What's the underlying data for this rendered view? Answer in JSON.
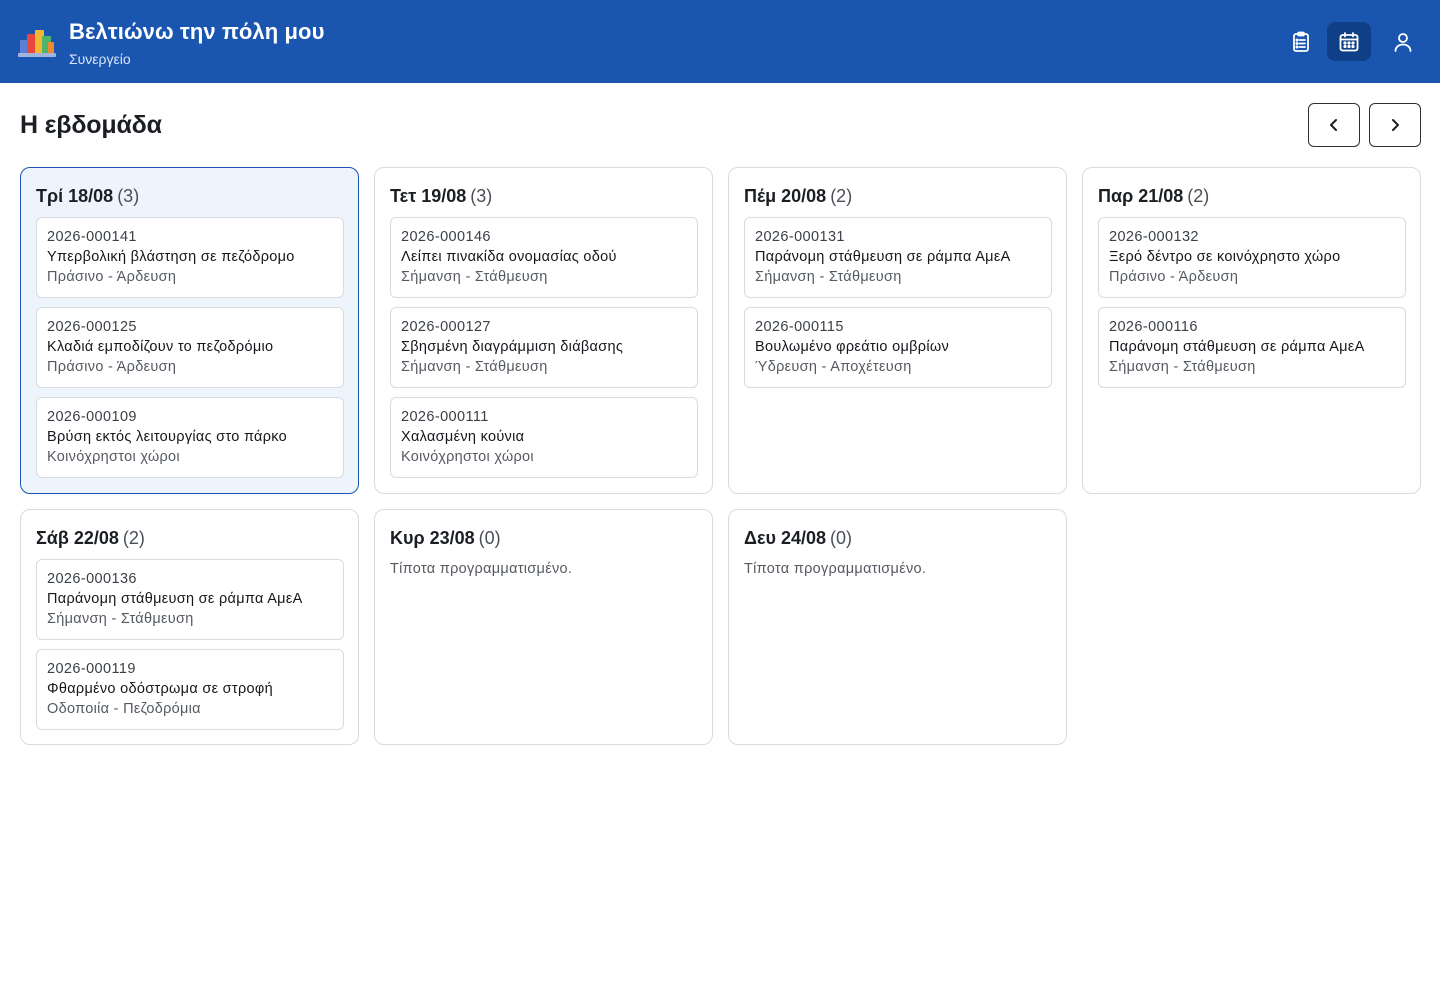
{
  "app": {
    "title": "Βελτιώνω την πόλη μου",
    "subtitle": "Συνεργείο"
  },
  "nav": {
    "icons": [
      "clipboard-list-icon",
      "calendar-icon",
      "user-icon"
    ],
    "active": "calendar-icon"
  },
  "colors": {
    "header_bg": "#1a56b0",
    "active_nav_bg": "#0f3f86",
    "today_bg": "#eef4fc",
    "today_border": "#1a56b0"
  },
  "page": {
    "title": "Η εβδομάδα"
  },
  "days": [
    {
      "label": "Τρί 18/08",
      "count": "(3)",
      "today": true,
      "tickets": [
        {
          "id": "2026-000141",
          "title": "Υπερβολική βλάστηση σε πεζόδρομο",
          "category": "Πράσινο - Άρδευση"
        },
        {
          "id": "2026-000125",
          "title": "Κλαδιά εμποδίζουν το πεζοδρόμιο",
          "category": "Πράσινο - Άρδευση"
        },
        {
          "id": "2026-000109",
          "title": "Βρύση εκτός λειτουργίας στο πάρκο",
          "category": "Κοινόχρηστοι χώροι"
        }
      ]
    },
    {
      "label": "Τετ 19/08",
      "count": "(3)",
      "today": false,
      "tickets": [
        {
          "id": "2026-000146",
          "title": "Λείπει πινακίδα ονομασίας οδού",
          "category": "Σήμανση - Στάθμευση"
        },
        {
          "id": "2026-000127",
          "title": "Σβησμένη διαγράμμιση διάβασης",
          "category": "Σήμανση - Στάθμευση"
        },
        {
          "id": "2026-000111",
          "title": "Χαλασμένη κούνια",
          "category": "Κοινόχρηστοι χώροι"
        }
      ]
    },
    {
      "label": "Πέμ 20/08",
      "count": "(2)",
      "today": false,
      "tickets": [
        {
          "id": "2026-000131",
          "title": "Παράνομη στάθμευση σε ράμπα ΑμεΑ",
          "category": "Σήμανση - Στάθμευση"
        },
        {
          "id": "2026-000115",
          "title": "Βουλωμένο φρεάτιο ομβρίων",
          "category": "Ύδρευση - Αποχέτευση"
        }
      ]
    },
    {
      "label": "Παρ 21/08",
      "count": "(2)",
      "today": false,
      "tickets": [
        {
          "id": "2026-000132",
          "title": "Ξερό δέντρο σε κοινόχρηστο χώρο",
          "category": "Πράσινο - Άρδευση"
        },
        {
          "id": "2026-000116",
          "title": "Παράνομη στάθμευση σε ράμπα ΑμεΑ",
          "category": "Σήμανση - Στάθμευση"
        }
      ]
    },
    {
      "label": "Σάβ 22/08",
      "count": "(2)",
      "today": false,
      "tickets": [
        {
          "id": "2026-000136",
          "title": "Παράνομη στάθμευση σε ράμπα ΑμεΑ",
          "category": "Σήμανση - Στάθμευση"
        },
        {
          "id": "2026-000119",
          "title": "Φθαρμένο οδόστρωμα σε στροφή",
          "category": "Οδοποιία - Πεζοδρόμια"
        }
      ]
    },
    {
      "label": "Κυρ 23/08",
      "count": "(0)",
      "today": false,
      "empty": "Τίποτα προγραμματισμένο.",
      "tickets": []
    },
    {
      "label": "Δευ 24/08",
      "count": "(0)",
      "today": false,
      "empty": "Τίποτα προγραμματισμένο.",
      "tickets": []
    }
  ]
}
